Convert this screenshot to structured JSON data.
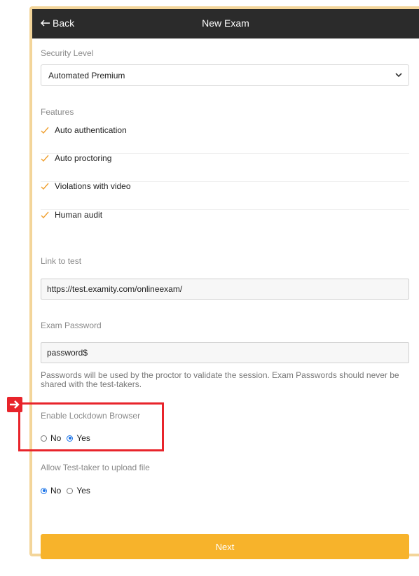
{
  "header": {
    "back_label": "Back",
    "title": "New Exam"
  },
  "security": {
    "label": "Security Level",
    "selected": "Automated Premium"
  },
  "features": {
    "label": "Features",
    "items": [
      {
        "label": "Auto authentication"
      },
      {
        "label": "Auto proctoring"
      },
      {
        "label": "Violations with video"
      },
      {
        "label": "Human audit"
      }
    ]
  },
  "link": {
    "label": "Link to test",
    "value": "https://test.examity.com/onlineexam/"
  },
  "password": {
    "label": "Exam Password",
    "value": "password$",
    "help": "Passwords will be used by the proctor to validate the session. Exam Passwords should never be shared with the test-takers."
  },
  "lockdown": {
    "label": "Enable Lockdown Browser",
    "no": "No",
    "yes": "Yes",
    "selected": "Yes"
  },
  "upload": {
    "label": "Allow Test-taker to upload file",
    "no": "No",
    "yes": "Yes",
    "selected": "No"
  },
  "next_label": "Next",
  "colors": {
    "accent": "#f7b32b",
    "header": "#2b2b2b",
    "highlight": "#e8242b",
    "check": "#f0a030",
    "radio": "#1a73e8"
  }
}
